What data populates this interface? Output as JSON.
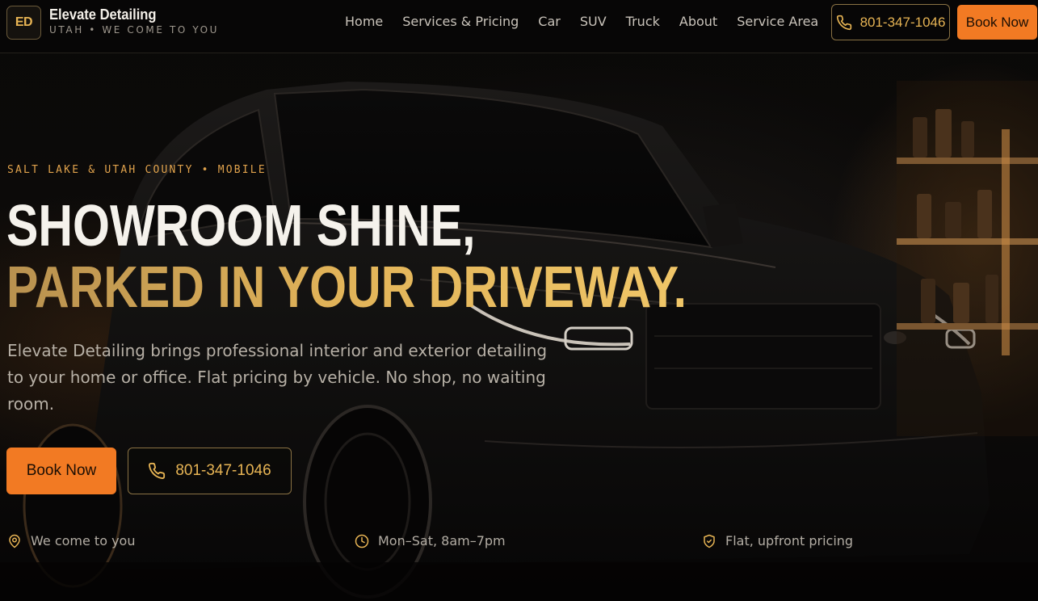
{
  "brand": {
    "badge": "ED",
    "name": "Elevate Detailing",
    "tagline": "UTAH • WE COME TO YOU"
  },
  "nav": {
    "items": [
      {
        "label": "Home"
      },
      {
        "label": "Services & Pricing"
      },
      {
        "label": "Car"
      },
      {
        "label": "SUV"
      },
      {
        "label": "Truck"
      },
      {
        "label": "About"
      },
      {
        "label": "Service Area"
      }
    ],
    "phone": "801-347-1046",
    "book_label": "Book Now"
  },
  "hero": {
    "eyebrow": "SALT LAKE & UTAH COUNTY • MOBILE",
    "headline_line1": "SHOWROOM SHINE,",
    "headline_line2": "PARKED IN YOUR DRIVEWAY.",
    "lede": "Elevate Detailing brings professional interior and exterior detailing to your home or office. Flat pricing by vehicle. No shop, no waiting room.",
    "book_label": "Book Now",
    "phone": "801-347-1046"
  },
  "features": [
    {
      "icon": "map-pin-icon",
      "label": "We come to you"
    },
    {
      "icon": "clock-icon",
      "label": "Mon–Sat, 8am–7pm"
    },
    {
      "icon": "shield-check-icon",
      "label": "Flat, upfront pricing"
    }
  ],
  "colors": {
    "accent_orange": "#f27a23",
    "accent_gold": "#e7b454",
    "background": "#070605",
    "text_primary": "#f5f2ec",
    "text_muted": "#b7b0a6"
  }
}
